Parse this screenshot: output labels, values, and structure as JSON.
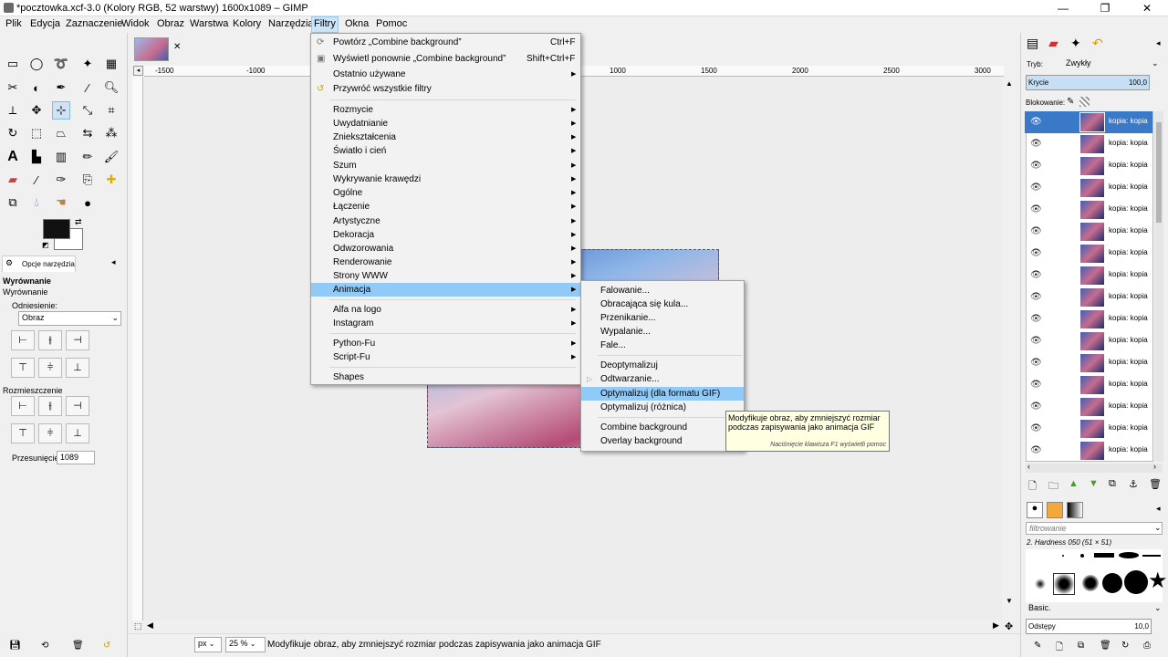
{
  "window": {
    "title": "*pocztowka.xcf-3.0 (Kolory RGB, 52 warstwy) 1600x1089 – GIMP",
    "minimize": "—",
    "maximize": "❐",
    "close": "✕"
  },
  "menubar": [
    "Plik",
    "Edycja",
    "Zaznaczenie",
    "Widok",
    "Obraz",
    "Warstwa",
    "Kolory",
    "Narzędzia",
    "Filtry",
    "Okna",
    "Pomoc"
  ],
  "ruler": {
    "ticks": [
      "-1500",
      "-1000",
      "1000",
      "1500",
      "2000",
      "2500",
      "3000"
    ]
  },
  "filters_menu": {
    "items": [
      {
        "label": "Powtórz „Combine background”",
        "shortcut": "Ctrl+F",
        "icon": "repeat-icon"
      },
      {
        "label": "Wyświetl ponownie „Combine background”",
        "shortcut": "Shift+Ctrl+F",
        "icon": "reshow-icon"
      },
      {
        "label": "Ostatnio używane",
        "shortcut": "",
        "arrow": "▶"
      },
      {
        "label": "Przywróć wszystkie filtry",
        "shortcut": "",
        "icon": "reset-icon"
      },
      {
        "label": "Rozmycie",
        "arrow": "▶"
      },
      {
        "label": "Uwydatnianie",
        "arrow": "▶"
      },
      {
        "label": "Zniekształcenia",
        "arrow": "▶"
      },
      {
        "label": "Światło i cień",
        "arrow": "▶"
      },
      {
        "label": "Szum",
        "arrow": "▶"
      },
      {
        "label": "Wykrywanie krawędzi",
        "arrow": "▶"
      },
      {
        "label": "Ogólne",
        "arrow": "▶"
      },
      {
        "label": "Łączenie",
        "arrow": "▶"
      },
      {
        "label": "Artystyczne",
        "arrow": "▶"
      },
      {
        "label": "Dekoracja",
        "arrow": "▶"
      },
      {
        "label": "Odwzorowania",
        "arrow": "▶"
      },
      {
        "label": "Renderowanie",
        "arrow": "▶"
      },
      {
        "label": "Strony WWW",
        "arrow": "▶"
      },
      {
        "label": "Animacja",
        "arrow": "▶"
      },
      {
        "label": "Alfa na logo",
        "arrow": "▶"
      },
      {
        "label": "Instagram",
        "arrow": "▶"
      },
      {
        "label": "Python-Fu",
        "arrow": "▶"
      },
      {
        "label": "Script-Fu",
        "arrow": "▶"
      },
      {
        "label": "Shapes",
        "arrow": ""
      }
    ]
  },
  "animation_menu": {
    "items": [
      "Falowanie...",
      "Obracająca się kula...",
      "Przenikanie...",
      "Wypalanie...",
      "Fale...",
      "Deoptymalizuj",
      "Odtwarzanie...",
      "Optymalizuj (dla formatu GIF)",
      "Optymalizuj (różnica)",
      "Combine background",
      "Overlay background"
    ]
  },
  "tooltip": {
    "line1": "Modyfikuje obraz, aby zmniejszyć rozmiar",
    "line2": "podczas zapisywania jako animacja GIF",
    "hint": "Naciśnięcie klawisza F1 wyświetli pomoc"
  },
  "tool_options": {
    "tab": "Opcje narzędzia",
    "title": "Wyrównanie",
    "subtitle": "Wyrównanie",
    "relative_label": "Odniesienie:",
    "relative_value": "Obraz",
    "distribute_label": "Rozmieszczenie",
    "offset_label": "Przesunięcie:",
    "offset_value": "1089"
  },
  "status": {
    "unit": "px",
    "zoom": "25 %",
    "message": "Modyfikuje obraz, aby zmniejszyć rozmiar podczas zapisywania jako animacja GIF"
  },
  "layers": {
    "mode_label": "Tryb:",
    "mode_value": "Zwykły",
    "opacity_label": "Krycie",
    "opacity_value": "100,0",
    "lock_label": "Blokowanie:",
    "names": [
      "kopia: kopia",
      "kopia: kopia",
      "kopia: kopia",
      "kopia: kopia",
      "kopia: kopia",
      "kopia: kopia",
      "kopia: kopia",
      "kopia: kopia",
      "kopia: kopia",
      "kopia: kopia",
      "kopia: kopia",
      "kopia: kopia",
      "kopia: kopia",
      "kopia: kopia",
      "kopia: kopia",
      "kopia: kopia"
    ]
  },
  "brushes": {
    "filter": "filtrowanie",
    "name": "2. Hardness 050 (51 × 51)",
    "preset": "Basic.",
    "spacing_label": "Odstępy",
    "spacing_value": "10,0"
  },
  "colors": {
    "fg": "#111111",
    "bg": "#ffffff",
    "highlight": "#91c9f7",
    "layer_selected": "#3a78c8"
  }
}
